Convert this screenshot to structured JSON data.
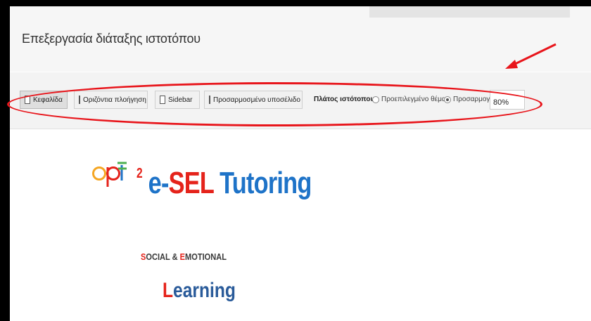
{
  "page": {
    "title": "Επεξεργασία διάταξης ιστοτόπου"
  },
  "toolbar": {
    "buttons": [
      {
        "label": "Κεφαλίδα",
        "active": true
      },
      {
        "label": "Οριζόντια πλοήγηση",
        "active": false
      },
      {
        "label": "Sidebar",
        "active": false
      },
      {
        "label": "Προσαρμοσμένο υποσέλιδο",
        "active": false
      }
    ],
    "width_label": "Πλάτος ιστότοπου:",
    "radio_default": {
      "label": "Προεπιλεγμένο θέμα",
      "selected": false
    },
    "radio_custom": {
      "label": "Προσαρμογή",
      "selected": true
    },
    "width_value": "80%"
  },
  "annotation": {
    "color": "#e8151b"
  },
  "logo": {
    "mark": "apt",
    "superscript": "2",
    "brand_prefix": "e-",
    "brand_sel": "SEL",
    "brand_rest": " Tutoring",
    "tagline": {
      "s": "S",
      "ocial": "OCIAL & ",
      "e": "E",
      "motional": "MOTIONAL"
    },
    "learning_l": "L",
    "learning_rest": "earning"
  },
  "colors": {
    "red": "#e5231b",
    "blue": "#1e73c8",
    "orange": "#f5a623",
    "green": "#4caf50"
  }
}
